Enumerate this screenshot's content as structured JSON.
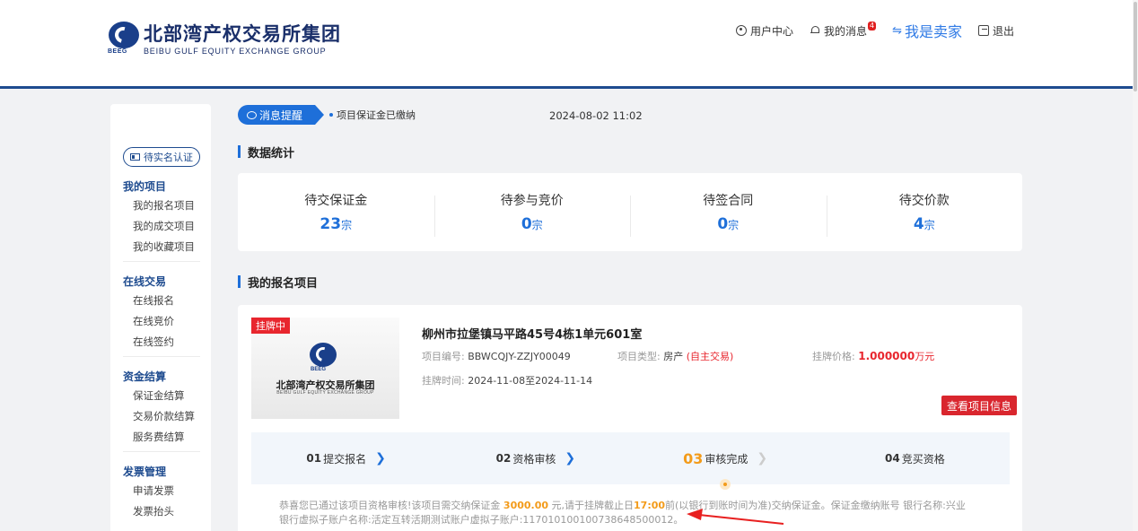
{
  "header": {
    "logo_cn": "北部湾产权交易所集团",
    "logo_en": "BEIBU GULF EQUITY EXCHANGE GROUP",
    "logo_abbr": "BEEG",
    "nav": {
      "user_center": "用户中心",
      "messages": "我的消息",
      "message_count": "4",
      "seller": "我是卖家",
      "logout": "退出"
    }
  },
  "sidebar": {
    "verify": "待实名认证",
    "groups": [
      {
        "title": "我的项目",
        "items": [
          "我的报名项目",
          "我的成交项目",
          "我的收藏项目"
        ]
      },
      {
        "title": "在线交易",
        "items": [
          "在线报名",
          "在线竞价",
          "在线签约"
        ]
      },
      {
        "title": "资金结算",
        "items": [
          "保证金结算",
          "交易价款结算",
          "服务费结算"
        ]
      },
      {
        "title": "发票管理",
        "items": [
          "申请发票",
          "发票抬头"
        ]
      }
    ]
  },
  "notice": {
    "tag": "消息提醒",
    "text": "项目保证金已缴纳",
    "time": "2024-08-02 11:02"
  },
  "stats_section": {
    "title": "数据统计",
    "items": [
      {
        "label": "待交保证金",
        "value": "23",
        "unit": "宗"
      },
      {
        "label": "待参与竞价",
        "value": "0",
        "unit": "宗"
      },
      {
        "label": "待签合同",
        "value": "0",
        "unit": "宗"
      },
      {
        "label": "待交价款",
        "value": "4",
        "unit": "宗"
      }
    ]
  },
  "projects_section": {
    "title": "我的报名项目",
    "project": {
      "status": "挂牌中",
      "title": "柳州市拉堡镇马平路45号4栋1单元601室",
      "code_label": "项目编号:",
      "code": "BBWCQJY-ZZJY00049",
      "type_label": "项目类型:",
      "type": "房产",
      "type_extra": "(自主交易)",
      "price_label": "挂牌价格:",
      "price": "1.000000",
      "price_unit": "万元",
      "period_label": "挂牌时间:",
      "period": "2024-11-08至2024-11-14",
      "view_button": "查看项目信息",
      "steps": [
        {
          "num": "01",
          "label": "提交报名"
        },
        {
          "num": "02",
          "label": "资格审核"
        },
        {
          "num": "03",
          "label": "审核完成"
        },
        {
          "num": "04",
          "label": "竞买资格"
        }
      ],
      "desc_1": "恭喜您已通过该项目资格审核!该项目需交纳保证金",
      "deposit": "3000.00",
      "desc_2": "元,请于挂牌截止日",
      "deadline": "17:00",
      "desc_3": "前(以银行到账时间为准)交纳保证金。保证金缴纳账号 银行名称:兴业银行虚拟子账户名称:活定互转活期测试账户虚拟子账户:117010100100738648500012。"
    }
  }
}
